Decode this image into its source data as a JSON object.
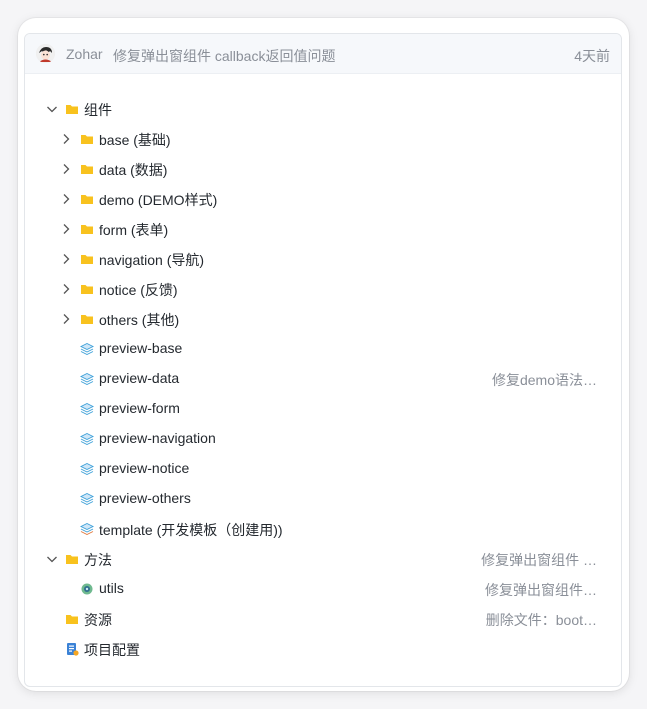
{
  "commit": {
    "author": "Zohar",
    "message": "修复弹出窗组件 callback返回值问题",
    "time": "4天前"
  },
  "tree": {
    "components": {
      "label": "组件",
      "children": {
        "base": "base (基础)",
        "data": "data (数据)",
        "demo": "demo (DEMO样式)",
        "form": "form (表单)",
        "navigation": "navigation (导航)",
        "notice": "notice (反馈)",
        "others": "others (其他)",
        "preview_base": "preview-base",
        "preview_data": "preview-data",
        "preview_data_commit": "修复demo语法…",
        "preview_form": "preview-form",
        "preview_navigation": "preview-navigation",
        "preview_notice": "preview-notice",
        "preview_others": "preview-others",
        "template": "template (开发模板（创建用))"
      }
    },
    "methods": {
      "label": "方法",
      "commit": "修复弹出窗组件 …",
      "children": {
        "utils": "utils",
        "utils_commit": "修复弹出窗组件…"
      }
    },
    "resources": {
      "label": "资源",
      "commit": "删除文件：boot…"
    },
    "project_config": {
      "label": "项目配置"
    }
  },
  "colors": {
    "folder": "#f8c21e",
    "text": "#24292f",
    "muted": "#8a8f98",
    "doc_blue": "#3b82d6"
  }
}
